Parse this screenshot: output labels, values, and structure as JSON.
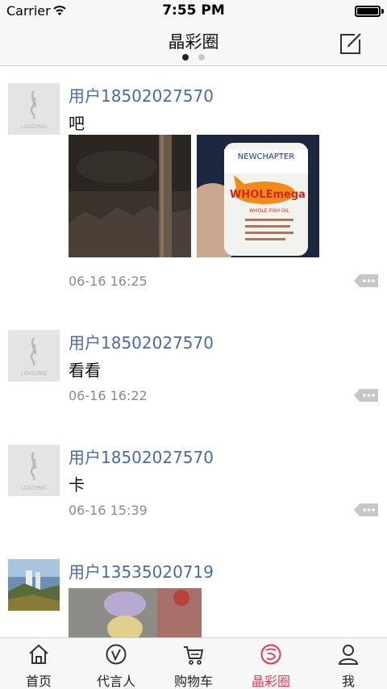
{
  "status_bar": {
    "carrier": "Carrier",
    "time": "7:55 PM"
  },
  "nav": {
    "title": "晶彩圈",
    "compose_icon": "compose-icon",
    "page_count": 2,
    "current_page": 1
  },
  "avatar_placeholder_text": "LOADING",
  "posts": [
    {
      "user": "用户18502027570",
      "text": "吧",
      "time": "06-16 16:25",
      "images": [
        "dark-night-photo",
        "fish-oil-bottle-photo"
      ]
    },
    {
      "user": "用户18502027570",
      "text": "看看",
      "time": "06-16 16:22"
    },
    {
      "user": "用户18502027570",
      "text": "卡",
      "time": "06-16 15:39"
    },
    {
      "user": "用户13535020719",
      "images": [
        "toy-photo"
      ]
    }
  ],
  "photo_text": {
    "brand": "NEWCHAPTER",
    "product": "WHOLEmega",
    "subtitle": "WHOLE FISH OIL"
  },
  "tabs": [
    {
      "label": "首页",
      "icon": "home-icon",
      "active": false
    },
    {
      "label": "代言人",
      "icon": "spokesperson-icon",
      "active": false
    },
    {
      "label": "购物车",
      "icon": "cart-icon",
      "active": false
    },
    {
      "label": "晶彩圈",
      "icon": "circle-icon",
      "active": true
    },
    {
      "label": "我",
      "icon": "profile-icon",
      "active": false
    }
  ],
  "colors": {
    "username": "#4b6b9f",
    "active_tab": "#e43a4c",
    "time": "#8a8a8a"
  }
}
